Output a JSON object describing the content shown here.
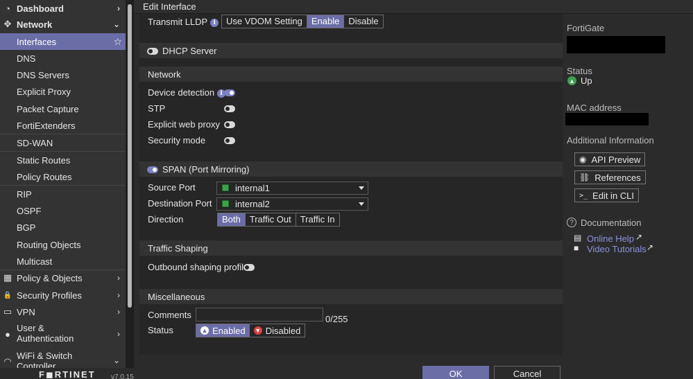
{
  "sidebar": {
    "items": [
      {
        "label": "Dashboard",
        "icon": "dashboard-icon",
        "glyph": "◔",
        "chevron": "›"
      },
      {
        "label": "Network",
        "icon": "network-icon",
        "glyph": "✥",
        "chevron": "⌄"
      },
      {
        "label": "Interfaces",
        "star": "☆"
      },
      {
        "label": "DNS"
      },
      {
        "label": "DNS Servers"
      },
      {
        "label": "Explicit Proxy"
      },
      {
        "label": "Packet Capture"
      },
      {
        "label": "FortiExtenders"
      },
      {
        "label": "SD-WAN"
      },
      {
        "label": "Static Routes"
      },
      {
        "label": "Policy Routes"
      },
      {
        "label": "RIP"
      },
      {
        "label": "OSPF"
      },
      {
        "label": "BGP"
      },
      {
        "label": "Routing Objects"
      },
      {
        "label": "Multicast"
      },
      {
        "label": "Policy & Objects",
        "icon": "policy-objects-icon",
        "glyph": "▦",
        "chevron": "›"
      },
      {
        "label": "Security Profiles",
        "icon": "lock-icon",
        "glyph": "🔒",
        "chevron": "›"
      },
      {
        "label": "VPN",
        "icon": "monitor-icon",
        "glyph": "▭",
        "chevron": "›"
      },
      {
        "label": "User &",
        "label2": "Authentication",
        "icon": "user-icon",
        "glyph": "●",
        "chevron": "›"
      },
      {
        "label": "WiFi & Switch",
        "label2": "Controller",
        "icon": "wifi-icon",
        "glyph": "◠",
        "chevron": "⌄"
      }
    ],
    "brand": "F◼RTINET",
    "version": "v7.0.15"
  },
  "header": {
    "title": "Edit Interface"
  },
  "form": {
    "transmit_lldp": {
      "label": "Transmit LLDP",
      "info": "i",
      "options": [
        "Use VDOM Setting",
        "Enable",
        "Disable"
      ],
      "selected": "Enable"
    },
    "dhcp_server": {
      "label": "DHCP Server",
      "enabled": false
    },
    "network": {
      "title": "Network",
      "device_detection": {
        "label": "Device detection",
        "info": "i",
        "enabled": true
      },
      "stp": {
        "label": "STP",
        "enabled": false
      },
      "explicit_web_proxy": {
        "label": "Explicit web proxy",
        "enabled": false
      },
      "security_mode": {
        "label": "Security mode",
        "enabled": false
      }
    },
    "span": {
      "label": "SPAN (Port Mirroring)",
      "enabled": true,
      "source_port": {
        "label": "Source Port",
        "value": "internal1"
      },
      "destination_port": {
        "label": "Destination Port",
        "value": "internal2"
      },
      "direction": {
        "label": "Direction",
        "options": [
          "Both",
          "Traffic Out",
          "Traffic In"
        ],
        "selected": "Both"
      }
    },
    "traffic_shaping": {
      "title": "Traffic Shaping",
      "outbound": {
        "label": "Outbound shaping profile",
        "enabled": false
      }
    },
    "misc": {
      "title": "Miscellaneous",
      "comments": {
        "label": "Comments",
        "value": "",
        "counter": "0/255"
      },
      "status": {
        "label": "Status",
        "options": [
          "Enabled",
          "Disabled"
        ],
        "selected": "Enabled"
      }
    }
  },
  "buttons": {
    "ok": "OK",
    "cancel": "Cancel"
  },
  "right_panel": {
    "fortigate_label": "FortiGate",
    "status_label": "Status",
    "status_value": "Up",
    "mac_label": "MAC address",
    "additional_label": "Additional Information",
    "api_preview": "API Preview",
    "references": "References",
    "edit_cli": "Edit in CLI",
    "cli_glyph": ">_",
    "documentation": "Documentation",
    "doc_glyph": "?",
    "online_help": "Online Help",
    "video_tutorials": "Video Tutorials"
  },
  "colors": {
    "accent": "#6b6ea6",
    "link": "#8d92de",
    "status_up": "#3aa34a"
  }
}
